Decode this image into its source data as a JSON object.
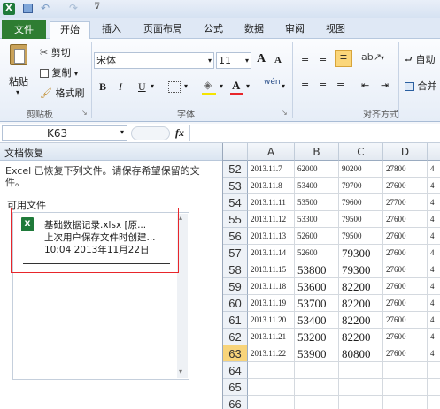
{
  "ribbon": {
    "file_tab": "文件",
    "tabs": [
      "开始",
      "插入",
      "页面布局",
      "公式",
      "数据",
      "审阅",
      "视图"
    ],
    "clipboard": {
      "paste": "粘贴",
      "cut": "剪切",
      "copy": "复制",
      "format_painter": "格式刷",
      "group": "剪贴板"
    },
    "font": {
      "name": "宋体",
      "size": "11",
      "bold": "B",
      "italic": "I",
      "underline": "U",
      "group": "字体",
      "grow": "A",
      "shrink": "A",
      "color_letter": "A"
    },
    "alignment": {
      "group": "对齐方式",
      "wrap": "自动",
      "merge": "合并"
    }
  },
  "formula_bar": {
    "name_box": "K63",
    "fx": "fx",
    "value": ""
  },
  "recovery": {
    "title": "文档恢复",
    "message": "Excel 已恢复下列文件。请保存希望保留的文件。",
    "available_label": "可用文件",
    "file_name": "基础数据记录.xlsx  [原...",
    "file_status": "上次用户保存文件时创建...",
    "file_time": "10:04 2013年11月22日"
  },
  "sheet": {
    "columns": [
      "A",
      "B",
      "C",
      "D"
    ],
    "selected_row": "63",
    "rows": [
      {
        "num": "52",
        "a": "2013.11.7",
        "b": "62000",
        "c": "90200",
        "d": "27800",
        "e": "4"
      },
      {
        "num": "53",
        "a": "2013.11.8",
        "b": "53400",
        "c": "79700",
        "d": "27600",
        "e": "4"
      },
      {
        "num": "54",
        "a": "2013.11.11",
        "b": "53500",
        "c": "79600",
        "d": "27700",
        "e": "4"
      },
      {
        "num": "55",
        "a": "2013.11.12",
        "b": "53300",
        "c": "79500",
        "d": "27600",
        "e": "4"
      },
      {
        "num": "56",
        "a": "2013.11.13",
        "b": "52600",
        "c": "79500",
        "d": "27600",
        "e": "4"
      },
      {
        "num": "57",
        "a": "2013.11.14",
        "b": "52600",
        "c": "79300",
        "d": "27600",
        "e": "4"
      },
      {
        "num": "58",
        "a": "2013.11.15",
        "b": "53800",
        "c": "79300",
        "d": "27600",
        "e": "4"
      },
      {
        "num": "59",
        "a": "2013.11.18",
        "b": "53600",
        "c": "82200",
        "d": "27600",
        "e": "4"
      },
      {
        "num": "60",
        "a": "2013.11.19",
        "b": "53700",
        "c": "82200",
        "d": "27600",
        "e": "4"
      },
      {
        "num": "61",
        "a": "2013.11.20",
        "b": "53400",
        "c": "82200",
        "d": "27600",
        "e": "4"
      },
      {
        "num": "62",
        "a": "2013.11.21",
        "b": "53200",
        "c": "82200",
        "d": "27600",
        "e": "4"
      },
      {
        "num": "63",
        "a": "2013.11.22",
        "b": "53900",
        "c": "80800",
        "d": "27600",
        "e": "4"
      },
      {
        "num": "64",
        "a": "",
        "b": "",
        "c": "",
        "d": "",
        "e": ""
      },
      {
        "num": "65",
        "a": "",
        "b": "",
        "c": "",
        "d": "",
        "e": ""
      },
      {
        "num": "66",
        "a": "",
        "b": "",
        "c": "",
        "d": "",
        "e": ""
      }
    ]
  },
  "colors": {
    "file_tab": "#2e7d32",
    "accent_red": "#e8262b",
    "selected_row_header": "#f8d47a",
    "excel_green": "#1f7a3a"
  }
}
